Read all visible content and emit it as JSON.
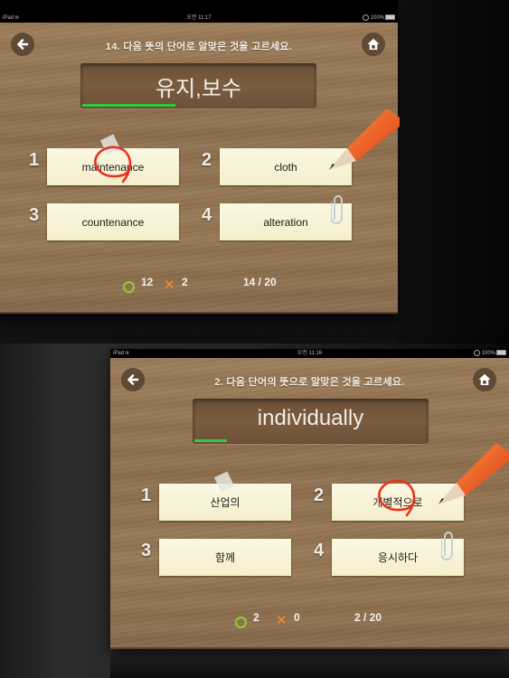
{
  "screens": [
    {
      "status": {
        "device": "iPad",
        "time": "오전 11:17",
        "battery": "100%"
      },
      "question": "14. 다음 뜻의 단어로 알맞은 것을 고르세요.",
      "word": "유지,보수",
      "timer_fraction": 0.4,
      "options": [
        {
          "number": "1",
          "text": "maintenance",
          "selected": true
        },
        {
          "number": "2",
          "text": "cloth",
          "selected": false
        },
        {
          "number": "3",
          "text": "countenance",
          "selected": false
        },
        {
          "number": "4",
          "text": "alteration",
          "selected": false
        }
      ],
      "score": {
        "correct": "12",
        "wrong": "2",
        "progress": "14 / 20"
      }
    },
    {
      "status": {
        "device": "iPad",
        "time": "오전 11:16",
        "battery": "100%"
      },
      "question": "2. 다음 단어의 뜻으로 알맞은 것을 고르세요.",
      "word": "individually",
      "timer_fraction": 0.14,
      "options": [
        {
          "number": "1",
          "text": "산업의",
          "selected": false
        },
        {
          "number": "2",
          "text": "개별적으로",
          "selected": true
        },
        {
          "number": "3",
          "text": "함께",
          "selected": false
        },
        {
          "number": "4",
          "text": "응시하다",
          "selected": false
        }
      ],
      "score": {
        "correct": "2",
        "wrong": "0",
        "progress": "2 / 20"
      }
    }
  ],
  "icons": {
    "back": "arrow-left-icon",
    "home": "home-icon",
    "correct": "circle-icon",
    "wrong": "x-icon"
  },
  "colors": {
    "timer": "#2ecb3a",
    "correct": "#8cd22a",
    "wrong": "#f0941c",
    "selection_mark": "#e8321c",
    "pencil": "#ef5a1e"
  }
}
